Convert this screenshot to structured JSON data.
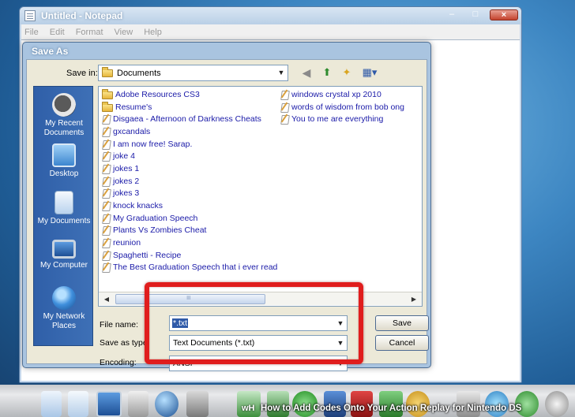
{
  "notepad": {
    "title": "Untitled - Notepad",
    "menu": [
      "File",
      "Edit",
      "Format",
      "View",
      "Help"
    ],
    "controls": {
      "minimize": "–",
      "maximize": "□",
      "close": "×"
    }
  },
  "dialog": {
    "title": "Save As",
    "save_in_label": "Save in:",
    "save_in_value": "Documents",
    "toolbar_icons": [
      "back-icon",
      "up-folder-icon",
      "new-folder-icon",
      "view-menu-icon"
    ],
    "places": [
      {
        "label": "My Recent Documents",
        "icon": "recent-documents-icon"
      },
      {
        "label": "Desktop",
        "icon": "desktop-icon"
      },
      {
        "label": "My Documents",
        "icon": "my-documents-icon"
      },
      {
        "label": "My Computer",
        "icon": "my-computer-icon"
      },
      {
        "label": "My Network Places",
        "icon": "network-places-icon"
      }
    ],
    "files_col1": [
      {
        "name": "Adobe Resources CS3",
        "type": "folder"
      },
      {
        "name": "Resume's",
        "type": "folder"
      },
      {
        "name": "Disgaea - Afternoon of Darkness Cheats",
        "type": "text"
      },
      {
        "name": "gxcandals",
        "type": "text"
      },
      {
        "name": "I am now free! Sarap.",
        "type": "text"
      },
      {
        "name": "joke 4",
        "type": "text"
      },
      {
        "name": "jokes 1",
        "type": "text"
      },
      {
        "name": "jokes 2",
        "type": "text"
      },
      {
        "name": "jokes 3",
        "type": "text"
      },
      {
        "name": "knock knacks",
        "type": "text"
      },
      {
        "name": "My Graduation Speech",
        "type": "text"
      },
      {
        "name": "Plants Vs Zombies Cheat",
        "type": "text"
      },
      {
        "name": "reunion",
        "type": "text"
      },
      {
        "name": "Spaghetti - Recipe",
        "type": "text"
      },
      {
        "name": "The Best Graduation Speech that i ever read",
        "type": "text"
      }
    ],
    "files_col2": [
      {
        "name": "windows crystal xp 2010",
        "type": "text"
      },
      {
        "name": "words of wisdom from bob ong",
        "type": "text"
      },
      {
        "name": "You to me are everything",
        "type": "text"
      }
    ],
    "file_name_label": "File name:",
    "file_name_value": "*.txt",
    "save_as_type_label": "Save as type:",
    "save_as_type_value": "Text Documents (*.txt)",
    "encoding_label": "Encoding:",
    "encoding_value": "ANSI",
    "save_button": "Save",
    "cancel_button": "Cancel"
  },
  "caption": {
    "logo": "wH",
    "text": "How to Add Codes Onto Your Action Replay for Nintendo DS"
  },
  "colors": {
    "highlight": "#e01d1d",
    "places_bar": "#2f5fa8",
    "file_text": "#1a1aa8"
  }
}
